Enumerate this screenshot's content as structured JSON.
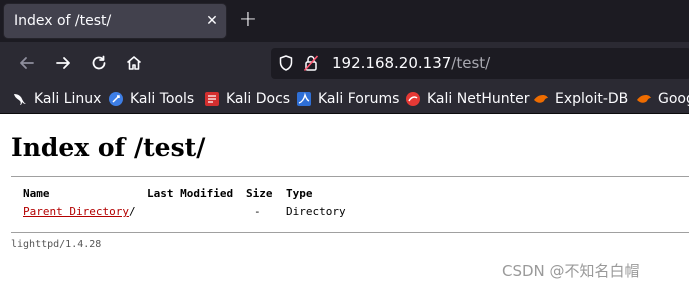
{
  "browser": {
    "tab_title": "Index of /test/",
    "tab_close_glyph": "✕",
    "new_tab_glyph": "+",
    "url_host": "192.168.20.137",
    "url_path": "/test/",
    "bookmarks": [
      {
        "label": "Kali Linux",
        "icon": "kali-dragon-icon"
      },
      {
        "label": "Kali Tools",
        "icon": "kali-tools-icon"
      },
      {
        "label": "Kali Docs",
        "icon": "kali-docs-icon"
      },
      {
        "label": "Kali Forums",
        "icon": "kali-forums-icon"
      },
      {
        "label": "Kali NetHunter",
        "icon": "nethunter-icon"
      },
      {
        "label": "Exploit-DB",
        "icon": "exploit-db-icon"
      },
      {
        "label": "Goog",
        "icon": "ghdb-icon"
      }
    ]
  },
  "page": {
    "heading": "Index of /test/",
    "table": {
      "headers": [
        "Name",
        "Last Modified",
        "Size",
        "Type"
      ],
      "rows": [
        {
          "name": "Parent Directory",
          "suffix": "/",
          "modified": "",
          "size": "-",
          "type": "Directory"
        }
      ]
    },
    "footer": "lighttpd/1.4.28"
  },
  "watermark": "CSDN @不知名白帽",
  "colors": {
    "tabstrip": "#1c1b22",
    "toolbar": "#2b2a33",
    "active_tab": "#42414d",
    "link": "#b30000"
  }
}
